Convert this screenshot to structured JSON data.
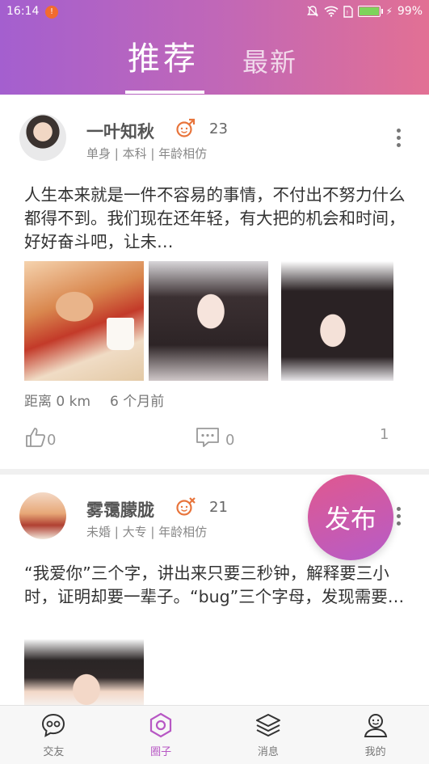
{
  "status_bar": {
    "time": "16:14",
    "battery": "99%",
    "battery_level": 0.99
  },
  "tabs": [
    {
      "label": "推荐",
      "active": true
    },
    {
      "label": "最新",
      "active": false
    }
  ],
  "posts": [
    {
      "name": "一叶知秋",
      "age": "23",
      "meta": "单身 | 本科 | 年龄相仿",
      "content": "人生本来就是一件不容易的事情，不付出不努力什么都得不到。我们现在还年轻，有大把的机会和时间，好好奋斗吧，让未…",
      "distance": "距离 0 km",
      "time_ago": "6 个月前",
      "likes": "0",
      "comments": "0",
      "shares": "1"
    },
    {
      "name": "雾霭朦胧",
      "age": "21",
      "meta": "未婚 | 大专 | 年龄相仿",
      "content": "“我爱你”三个字，讲出来只要三秒钟，解释要三小时，证明却要一辈子。“bug”三个字母，发现需要三秒，找到需要三小时，…"
    }
  ],
  "fab_label": "发布",
  "bottom_nav": [
    {
      "label": "交友",
      "icon": "chat-bubble-icon",
      "active": false
    },
    {
      "label": "圈子",
      "icon": "hexagon-icon",
      "active": true
    },
    {
      "label": "消息",
      "icon": "layers-icon",
      "active": false
    },
    {
      "label": "我的",
      "icon": "profile-icon",
      "active": false
    }
  ],
  "colors": {
    "header_start": "#a45fcf",
    "header_end": "#e27094",
    "gender_icon": "#e8743b",
    "accent": "#b757c4"
  }
}
